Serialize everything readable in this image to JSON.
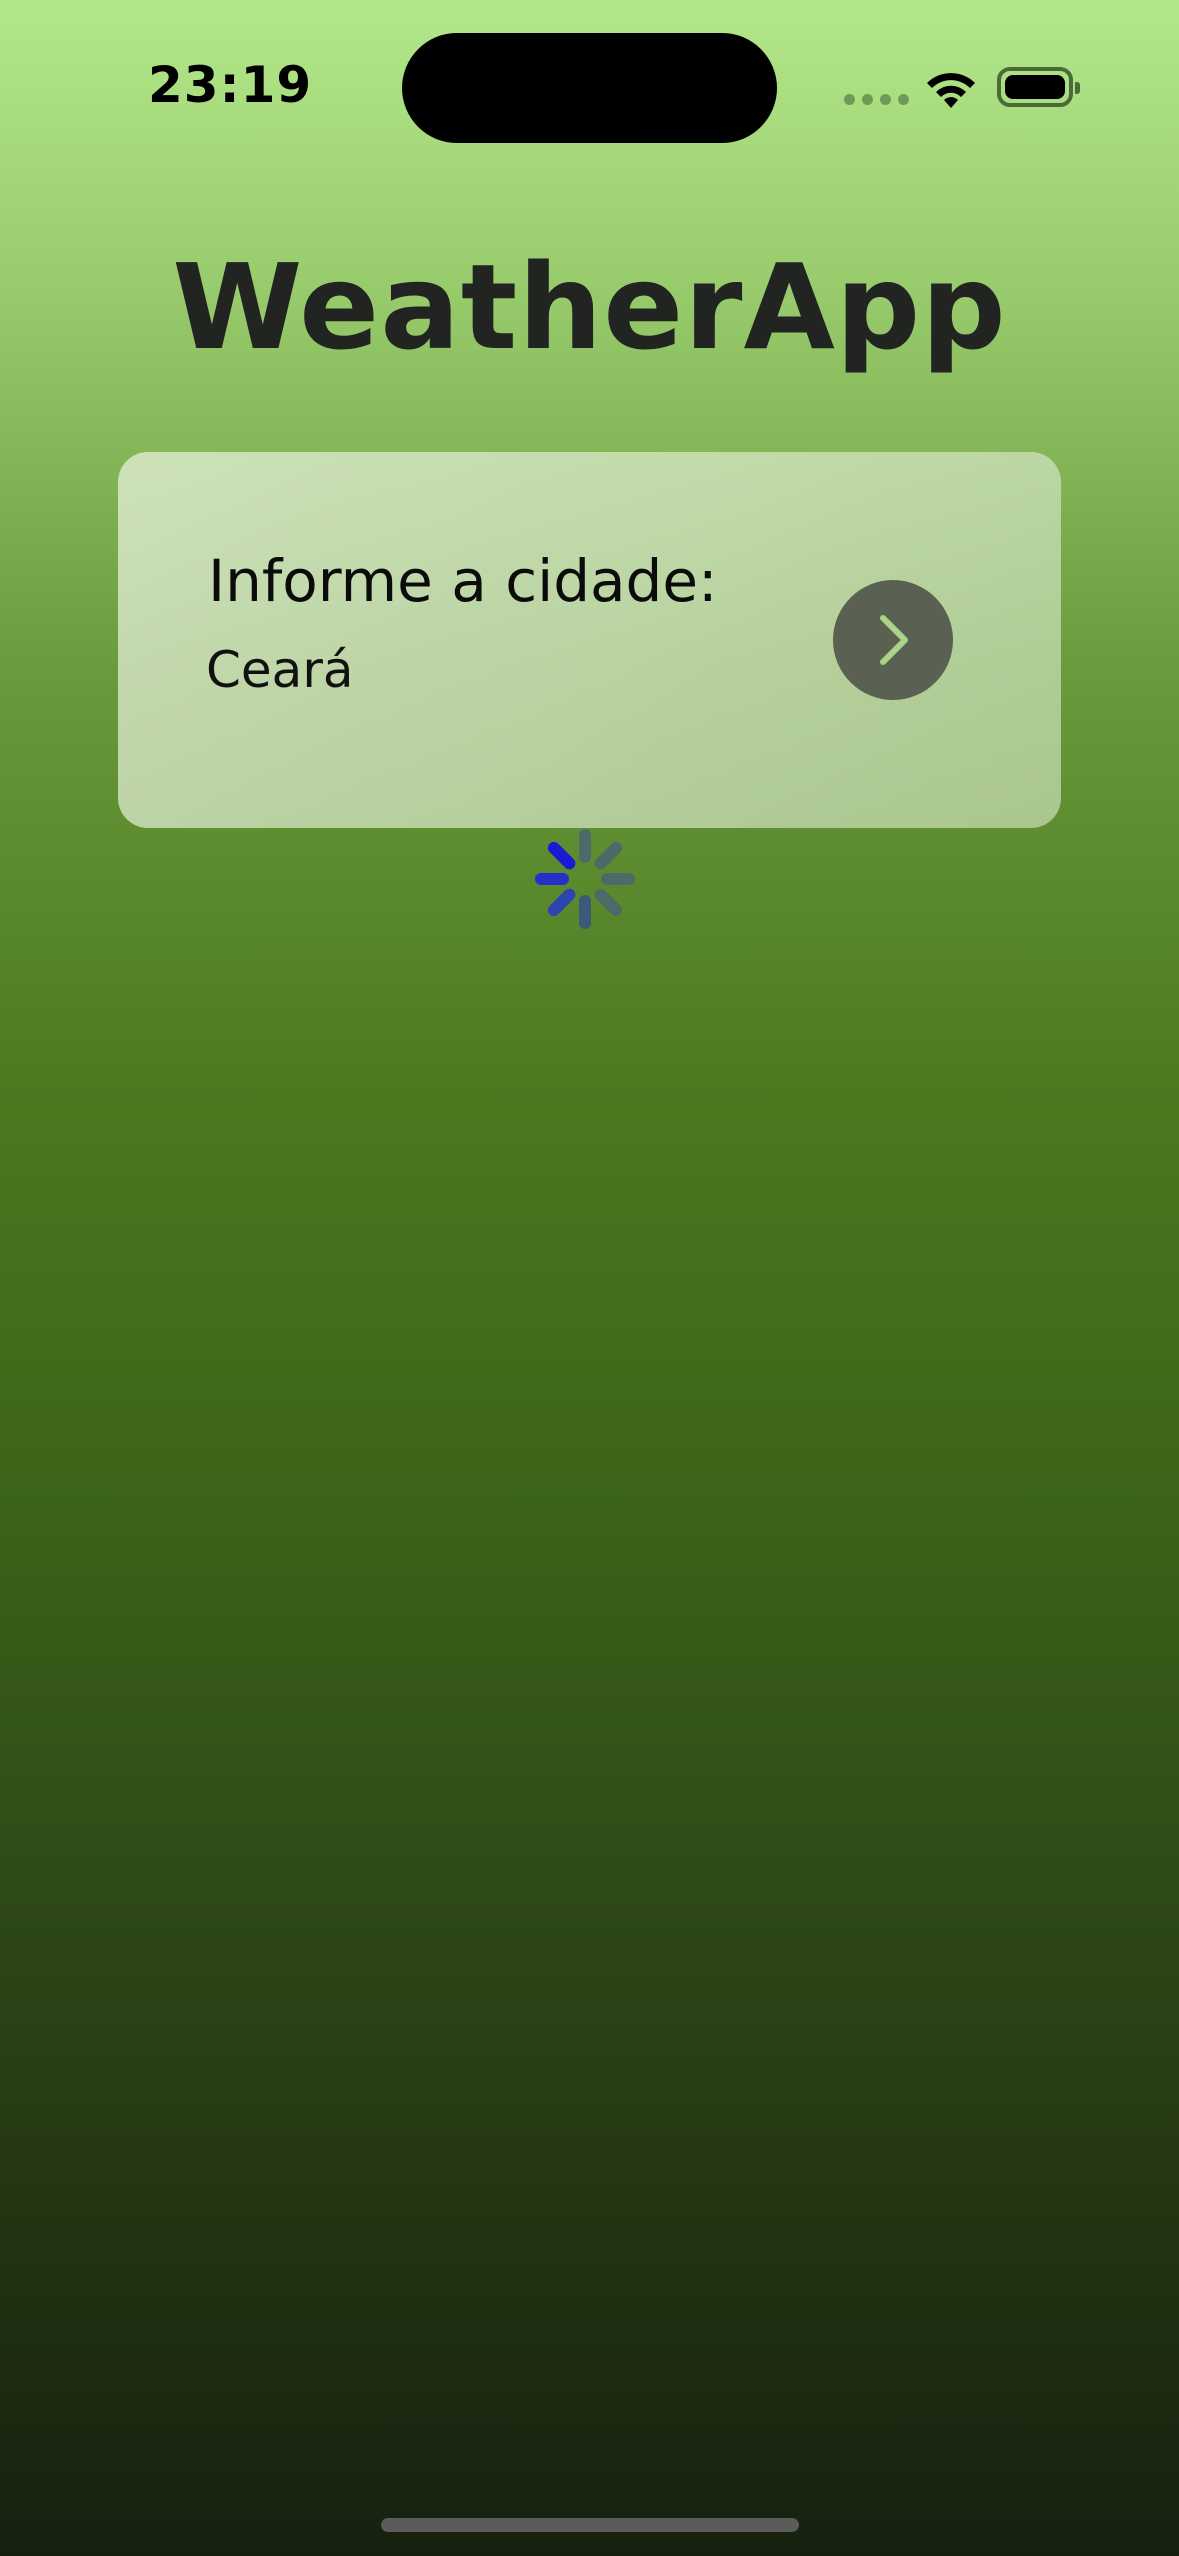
{
  "status_bar": {
    "time": "23:19",
    "signal_icon": "cellular-signal-icon",
    "wifi_icon": "wifi-icon",
    "battery_icon": "battery-icon"
  },
  "app": {
    "title": "WeatherApp"
  },
  "search_card": {
    "label": "Informe a cidade:",
    "input_value": "Ceará",
    "submit_icon": "chevron-right-icon"
  },
  "loading": {
    "icon": "activity-spinner-icon"
  },
  "colors": {
    "title": "#222422",
    "button_bg": "#5a6152",
    "chevron": "#a9d488",
    "spinner_active": "#1a1ad6",
    "spinner_inactive": "#4d6a6a"
  }
}
